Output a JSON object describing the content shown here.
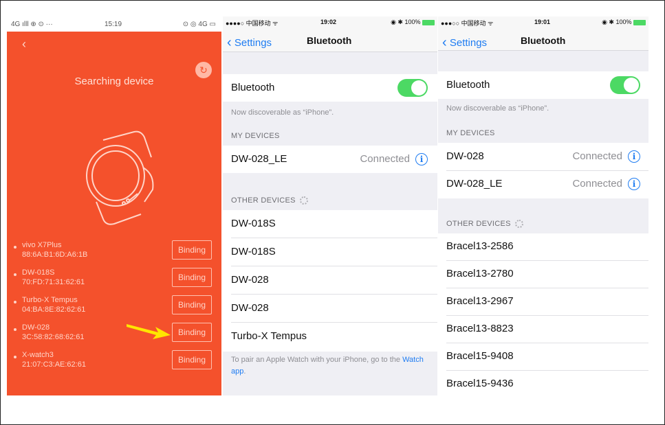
{
  "panel1": {
    "status_left": "4G ılll ⊕ ⊙ ···",
    "status_time": "15:19",
    "status_right": "⊙ ◎ 4G ▭",
    "back_label": "‹",
    "title": "Searching device",
    "refresh_icon": "refresh-icon",
    "devices": [
      {
        "name": "vivo X7Plus",
        "mac": "88:6A:B1:6D:A6:1B",
        "action": "Binding"
      },
      {
        "name": "DW-018S",
        "mac": "70:FD:71:31:62:61",
        "action": "Binding"
      },
      {
        "name": "Turbo-X Tempus",
        "mac": "04:BA:8E:82:62:61",
        "action": "Binding"
      },
      {
        "name": "DW-028",
        "mac": "3C:58:82:68:62:61",
        "action": "Binding"
      },
      {
        "name": "X-watch3",
        "mac": "21:07:C3:AE:62:61",
        "action": "Binding"
      }
    ],
    "colors": {
      "background": "#f4512c",
      "arrow": "#ffe500"
    }
  },
  "panel2": {
    "status_left": "●●●●○ 中国移动 ᯤ",
    "status_time": "19:02",
    "status_right": "◉ ✱ 100%",
    "back_label": "Settings",
    "title": "Bluetooth",
    "bluetooth_label": "Bluetooth",
    "discoverable": "Now discoverable as “iPhone”.",
    "my_devices_header": "MY DEVICES",
    "my_devices": [
      {
        "name": "DW-028_LE",
        "status": "Connected"
      }
    ],
    "other_devices_header": "OTHER DEVICES",
    "other_devices": [
      "DW-018S",
      "DW-018S",
      "DW-028",
      "DW-028",
      "Turbo-X Tempus"
    ],
    "footer_text": "To pair an Apple Watch with your iPhone, go to the ",
    "footer_link": "Watch app",
    "footer_end": "."
  },
  "panel3": {
    "status_left": "●●●○○ 中国移动 ᯤ",
    "status_time": "19:01",
    "status_right": "◉ ✱ 100%",
    "back_label": "Settings",
    "title": "Bluetooth",
    "bluetooth_label": "Bluetooth",
    "discoverable": "Now discoverable as “iPhone”.",
    "my_devices_header": "MY DEVICES",
    "my_devices": [
      {
        "name": "DW-028",
        "status": "Connected"
      },
      {
        "name": "DW-028_LE",
        "status": "Connected"
      }
    ],
    "other_devices_header": "OTHER DEVICES",
    "other_devices": [
      "Bracel13-2586",
      "Bracel13-2780",
      "Bracel13-2967",
      "Bracel13-8823",
      "Bracel15-9408",
      "Bracel15-9436"
    ]
  },
  "ios_colors": {
    "tint": "#1e7cf2",
    "toggle_on": "#4cd964",
    "group_bg": "#efeff4"
  }
}
